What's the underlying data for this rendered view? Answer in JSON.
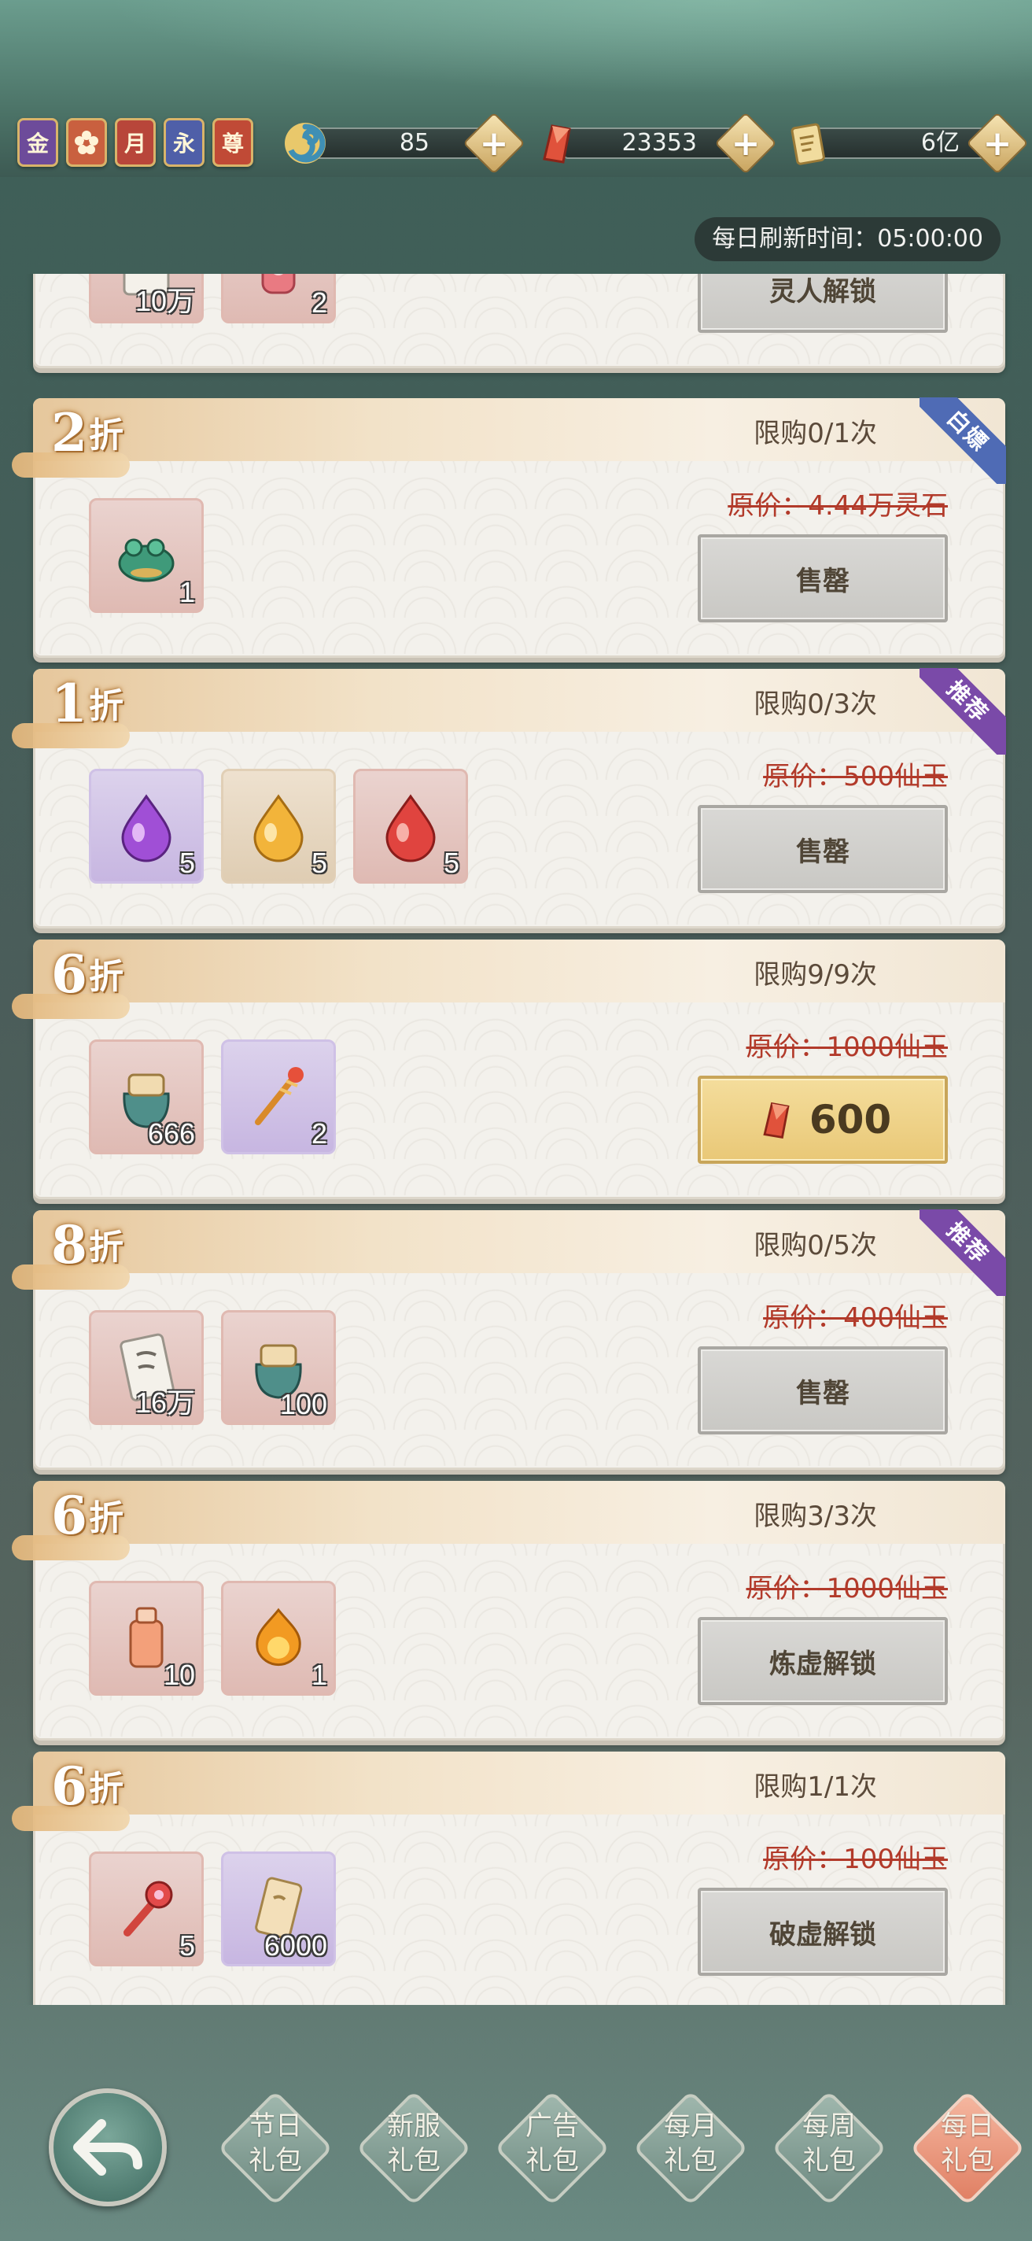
{
  "header": {
    "badges": [
      {
        "label": "金",
        "color": "#6d4b9a"
      },
      {
        "label": "",
        "color": "#c9603f"
      },
      {
        "label": "月",
        "color": "#b8463a"
      },
      {
        "label": "永",
        "color": "#4f5fa8"
      },
      {
        "label": "尊",
        "color": "#c04a36"
      }
    ],
    "currencies": [
      {
        "name": "spirit-swirl-icon",
        "value": "85"
      },
      {
        "name": "red-jade-icon",
        "value": "23353"
      },
      {
        "name": "scroll-coin-icon",
        "value": "6亿"
      }
    ],
    "plus_label": "+"
  },
  "refresh_text": "每日刷新时间：05:00:00",
  "cards": [
    {
      "discount_num": "",
      "discount_unit": "",
      "limit": "",
      "ribbon": "",
      "original_price": "",
      "button": "灵人解锁",
      "items": [
        {
          "icon": "scroll-icon",
          "qty": "10万",
          "bg": "pink"
        },
        {
          "icon": "potion-jar-icon",
          "qty": "2",
          "bg": "pink"
        }
      ]
    },
    {
      "discount_num": "2",
      "discount_unit": "折",
      "limit": "限购0/1次",
      "ribbon": "白嫖",
      "ribbon_color": "#4f6bb5",
      "original_price": "原价：4.44万灵石",
      "button": "售罄",
      "items": [
        {
          "icon": "jade-toad-icon",
          "qty": "1",
          "bg": "pink"
        }
      ]
    },
    {
      "discount_num": "1",
      "discount_unit": "折",
      "limit": "限购0/3次",
      "ribbon": "推荐",
      "ribbon_color": "#7a4aa8",
      "original_price": "原价：500仙玉",
      "button": "售罄",
      "items": [
        {
          "icon": "purple-gem-icon",
          "qty": "5",
          "bg": "purple"
        },
        {
          "icon": "gold-gem-icon",
          "qty": "5",
          "bg": "tan"
        },
        {
          "icon": "red-gem-icon",
          "qty": "5",
          "bg": "pink"
        }
      ]
    },
    {
      "discount_num": "6",
      "discount_unit": "折",
      "limit": "限购9/9次",
      "ribbon": "",
      "original_price": "原价：1000仙玉",
      "button": "600",
      "button_gold": true,
      "items": [
        {
          "icon": "treasure-bag-icon",
          "qty": "666",
          "bg": "pink"
        },
        {
          "icon": "sword-charm-icon",
          "qty": "2",
          "bg": "purple"
        }
      ]
    },
    {
      "discount_num": "8",
      "discount_unit": "折",
      "limit": "限购0/5次",
      "ribbon": "推荐",
      "ribbon_color": "#7a4aa8",
      "original_price": "原价：400仙玉",
      "button": "售罄",
      "items": [
        {
          "icon": "cultivation-scroll-icon",
          "qty": "16万",
          "bg": "pink"
        },
        {
          "icon": "treasure-bag-icon",
          "qty": "100",
          "bg": "pink"
        }
      ]
    },
    {
      "discount_num": "6",
      "discount_unit": "折",
      "limit": "限购3/3次",
      "ribbon": "",
      "original_price": "原价：1000仙玉",
      "button": "炼虚解锁",
      "items": [
        {
          "icon": "elixir-bottle-icon",
          "qty": "10",
          "bg": "pink"
        },
        {
          "icon": "flame-orb-icon",
          "qty": "1",
          "bg": "pink"
        }
      ]
    },
    {
      "discount_num": "6",
      "discount_unit": "折",
      "limit": "限购1/1次",
      "ribbon": "",
      "original_price": "原价：100仙玉",
      "button": "破虚解锁",
      "items": [
        {
          "icon": "ruby-key-icon",
          "qty": "5",
          "bg": "pink"
        },
        {
          "icon": "talisman-card-icon",
          "qty": "6000",
          "bg": "purple"
        }
      ]
    }
  ],
  "tabs": [
    {
      "line1": "节日",
      "line2": "礼包",
      "active": false
    },
    {
      "line1": "新服",
      "line2": "礼包",
      "active": false
    },
    {
      "line1": "广告",
      "line2": "礼包",
      "active": false
    },
    {
      "line1": "每月",
      "line2": "礼包",
      "active": false
    },
    {
      "line1": "每周",
      "line2": "礼包",
      "active": false
    },
    {
      "line1": "每日",
      "line2": "礼包",
      "active": true
    }
  ]
}
